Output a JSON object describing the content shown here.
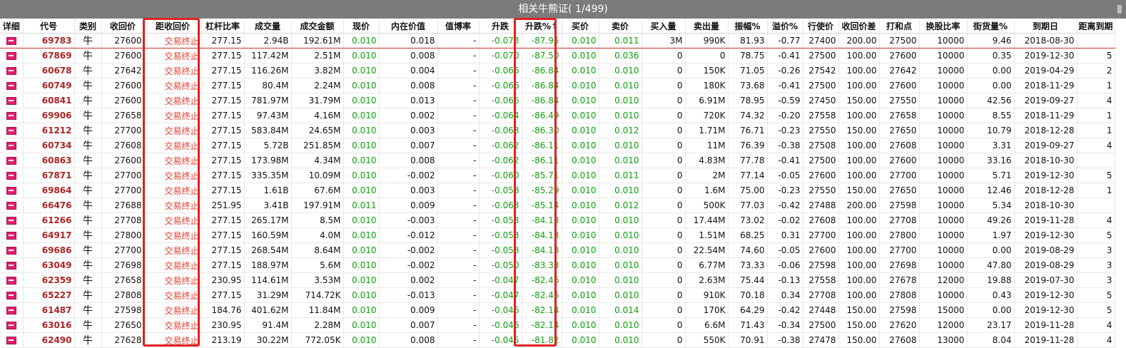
{
  "title": "相关牛熊证( 1/499)",
  "columns": [
    "详细",
    "代号",
    "类别",
    "收回价",
    "距收回价",
    "杠杆比率",
    "成交量",
    "成交金额",
    "现价",
    "内在价值",
    "值博率",
    "升跌",
    "升跌%↑",
    "买价",
    "卖价",
    "买入量",
    "卖出量",
    "振幅%",
    "溢价%",
    "行使价",
    "收回价差",
    "打和点",
    "换股比率",
    "街货量%",
    "到期日",
    "距离到期"
  ],
  "rows": [
    {
      "code": "69783",
      "type": "牛",
      "callprice": "27600",
      "status": "交易终止",
      "leverage": "277.15",
      "volume": "2.94B",
      "turnover": "192.61M",
      "price": "0.010",
      "intrinsic": "0.018",
      "worth": "-",
      "change": "-0.073",
      "changepct": "-87.95",
      "bid": "0.010",
      "ask": "0.011",
      "bidvol": "3M",
      "askvol": "990K",
      "amplitude": "81.93",
      "premium": "-0.77",
      "strike": "27400",
      "calldiff": "200.00",
      "breakeven": "27500",
      "ratio": "10000",
      "outstanding": "9.46",
      "expiry": "2018-08-30",
      "daysleft": ""
    },
    {
      "code": "67869",
      "type": "牛",
      "callprice": "27600",
      "status": "交易终止",
      "leverage": "277.15",
      "volume": "117.42M",
      "turnover": "2.51M",
      "price": "0.010",
      "intrinsic": "0.008",
      "worth": "-",
      "change": "-0.070",
      "changepct": "-87.50",
      "bid": "0.010",
      "ask": "0.036",
      "bidvol": "0",
      "askvol": "0",
      "amplitude": "78.75",
      "premium": "-0.41",
      "strike": "27500",
      "calldiff": "100.00",
      "breakeven": "27600",
      "ratio": "10000",
      "outstanding": "0.35",
      "expiry": "2019-12-30",
      "daysleft": "5"
    },
    {
      "code": "60678",
      "type": "牛",
      "callprice": "27642",
      "status": "交易终止",
      "leverage": "277.15",
      "volume": "116.26M",
      "turnover": "3.82M",
      "price": "0.010",
      "intrinsic": "0.004",
      "worth": "-",
      "change": "-0.066",
      "changepct": "-86.84",
      "bid": "0.010",
      "ask": "0.010",
      "bidvol": "0",
      "askvol": "150K",
      "amplitude": "71.05",
      "premium": "-0.26",
      "strike": "27542",
      "calldiff": "100.00",
      "breakeven": "27642",
      "ratio": "10000",
      "outstanding": "0.00",
      "expiry": "2019-04-29",
      "daysleft": "2"
    },
    {
      "code": "60749",
      "type": "牛",
      "callprice": "27600",
      "status": "交易终止",
      "leverage": "277.15",
      "volume": "80.4M",
      "turnover": "2.24M",
      "price": "0.010",
      "intrinsic": "0.008",
      "worth": "-",
      "change": "-0.066",
      "changepct": "-86.84",
      "bid": "0.010",
      "ask": "0.010",
      "bidvol": "0",
      "askvol": "180K",
      "amplitude": "73.68",
      "premium": "-0.41",
      "strike": "27500",
      "calldiff": "100.00",
      "breakeven": "27600",
      "ratio": "10000",
      "outstanding": "0.00",
      "expiry": "2018-11-29",
      "daysleft": "1"
    },
    {
      "code": "60841",
      "type": "牛",
      "callprice": "27600",
      "status": "交易终止",
      "leverage": "277.15",
      "volume": "781.97M",
      "turnover": "31.79M",
      "price": "0.010",
      "intrinsic": "0.013",
      "worth": "-",
      "change": "-0.066",
      "changepct": "-86.84",
      "bid": "0.010",
      "ask": "0.010",
      "bidvol": "0",
      "askvol": "6.91M",
      "amplitude": "78.95",
      "premium": "-0.59",
      "strike": "27450",
      "calldiff": "150.00",
      "breakeven": "27550",
      "ratio": "10000",
      "outstanding": "42.56",
      "expiry": "2019-09-27",
      "daysleft": "4"
    },
    {
      "code": "69906",
      "type": "牛",
      "callprice": "27658",
      "status": "交易终止",
      "leverage": "277.15",
      "volume": "97.43M",
      "turnover": "4.16M",
      "price": "0.010",
      "intrinsic": "0.002",
      "worth": "-",
      "change": "-0.064",
      "changepct": "-86.49",
      "bid": "0.010",
      "ask": "0.010",
      "bidvol": "0",
      "askvol": "720K",
      "amplitude": "74.32",
      "premium": "-0.20",
      "strike": "27558",
      "calldiff": "100.00",
      "breakeven": "27658",
      "ratio": "10000",
      "outstanding": "8.55",
      "expiry": "2018-11-29",
      "daysleft": "1"
    },
    {
      "code": "61212",
      "type": "牛",
      "callprice": "27700",
      "status": "交易终止",
      "leverage": "277.15",
      "volume": "583.84M",
      "turnover": "24.65M",
      "price": "0.010",
      "intrinsic": "0.003",
      "worth": "-",
      "change": "-0.063",
      "changepct": "-86.30",
      "bid": "0.010",
      "ask": "0.012",
      "bidvol": "0",
      "askvol": "1.71M",
      "amplitude": "76.71",
      "premium": "-0.23",
      "strike": "27550",
      "calldiff": "150.00",
      "breakeven": "27650",
      "ratio": "10000",
      "outstanding": "10.79",
      "expiry": "2018-12-28",
      "daysleft": "1"
    },
    {
      "code": "60734",
      "type": "牛",
      "callprice": "27608",
      "status": "交易终止",
      "leverage": "277.15",
      "volume": "5.72B",
      "turnover": "251.85M",
      "price": "0.010",
      "intrinsic": "0.007",
      "worth": "-",
      "change": "-0.062",
      "changepct": "-86.11",
      "bid": "0.010",
      "ask": "0.010",
      "bidvol": "0",
      "askvol": "11M",
      "amplitude": "76.39",
      "premium": "-0.38",
      "strike": "27508",
      "calldiff": "100.00",
      "breakeven": "27608",
      "ratio": "10000",
      "outstanding": "3.31",
      "expiry": "2019-09-27",
      "daysleft": "4"
    },
    {
      "code": "60863",
      "type": "牛",
      "callprice": "27600",
      "status": "交易终止",
      "leverage": "277.15",
      "volume": "173.98M",
      "turnover": "4.34M",
      "price": "0.010",
      "intrinsic": "0.008",
      "worth": "-",
      "change": "-0.062",
      "changepct": "-86.11",
      "bid": "0.010",
      "ask": "0.010",
      "bidvol": "0",
      "askvol": "4.83M",
      "amplitude": "77.78",
      "premium": "-0.41",
      "strike": "27500",
      "calldiff": "100.00",
      "breakeven": "27600",
      "ratio": "10000",
      "outstanding": "33.16",
      "expiry": "2018-10-30",
      "daysleft": ""
    },
    {
      "code": "67871",
      "type": "牛",
      "callprice": "27700",
      "status": "交易终止",
      "leverage": "277.15",
      "volume": "335.35M",
      "turnover": "10.09M",
      "price": "0.010",
      "intrinsic": "-0.002",
      "worth": "-",
      "change": "-0.060",
      "changepct": "-85.71",
      "bid": "0.010",
      "ask": "0.011",
      "bidvol": "0",
      "askvol": "2M",
      "amplitude": "77.14",
      "premium": "-0.05",
      "strike": "27600",
      "calldiff": "100.00",
      "breakeven": "27700",
      "ratio": "10000",
      "outstanding": "5.71",
      "expiry": "2019-12-30",
      "daysleft": "5"
    },
    {
      "code": "69864",
      "type": "牛",
      "callprice": "27700",
      "status": "交易终止",
      "leverage": "277.15",
      "volume": "1.61B",
      "turnover": "67.6M",
      "price": "0.010",
      "intrinsic": "0.003",
      "worth": "-",
      "change": "-0.058",
      "changepct": "-85.29",
      "bid": "0.010",
      "ask": "0.010",
      "bidvol": "0",
      "askvol": "1.6M",
      "amplitude": "75.00",
      "premium": "-0.23",
      "strike": "27550",
      "calldiff": "150.00",
      "breakeven": "27650",
      "ratio": "10000",
      "outstanding": "12.46",
      "expiry": "2018-12-28",
      "daysleft": "1"
    },
    {
      "code": "66476",
      "type": "牛",
      "callprice": "27688",
      "status": "交易终止",
      "leverage": "251.95",
      "volume": "3.41B",
      "turnover": "197.91M",
      "price": "0.011",
      "intrinsic": "0.009",
      "worth": "-",
      "change": "-0.063",
      "changepct": "-85.14",
      "bid": "0.010",
      "ask": "0.012",
      "bidvol": "0",
      "askvol": "500K",
      "amplitude": "77.03",
      "premium": "-0.42",
      "strike": "27488",
      "calldiff": "200.00",
      "breakeven": "27598",
      "ratio": "10000",
      "outstanding": "5.34",
      "expiry": "2018-10-30",
      "daysleft": ""
    },
    {
      "code": "61266",
      "type": "牛",
      "callprice": "27708",
      "status": "交易终止",
      "leverage": "277.15",
      "volume": "265.17M",
      "turnover": "8.5M",
      "price": "0.010",
      "intrinsic": "-0.003",
      "worth": "-",
      "change": "-0.053",
      "changepct": "-84.13",
      "bid": "0.010",
      "ask": "0.010",
      "bidvol": "0",
      "askvol": "17.44M",
      "amplitude": "73.02",
      "premium": "-0.02",
      "strike": "27608",
      "calldiff": "100.00",
      "breakeven": "27708",
      "ratio": "10000",
      "outstanding": "49.26",
      "expiry": "2019-11-28",
      "daysleft": "4"
    },
    {
      "code": "64917",
      "type": "牛",
      "callprice": "27800",
      "status": "交易终止",
      "leverage": "277.15",
      "volume": "160.59M",
      "turnover": "4.0M",
      "price": "0.010",
      "intrinsic": "-0.012",
      "worth": "-",
      "change": "-0.053",
      "changepct": "-84.13",
      "bid": "0.010",
      "ask": "0.010",
      "bidvol": "0",
      "askvol": "1.51M",
      "amplitude": "68.25",
      "premium": "0.31",
      "strike": "27700",
      "calldiff": "100.00",
      "breakeven": "27800",
      "ratio": "10000",
      "outstanding": "1.97",
      "expiry": "2019-12-30",
      "daysleft": "5"
    },
    {
      "code": "69686",
      "type": "牛",
      "callprice": "27700",
      "status": "交易终止",
      "leverage": "277.15",
      "volume": "268.54M",
      "turnover": "8.64M",
      "price": "0.010",
      "intrinsic": "-0.002",
      "worth": "-",
      "change": "-0.053",
      "changepct": "-84.13",
      "bid": "0.010",
      "ask": "0.010",
      "bidvol": "0",
      "askvol": "22.54M",
      "amplitude": "74.60",
      "premium": "-0.05",
      "strike": "27600",
      "calldiff": "100.00",
      "breakeven": "27700",
      "ratio": "10000",
      "outstanding": "0.00",
      "expiry": "2019-08-29",
      "daysleft": "3"
    },
    {
      "code": "63049",
      "type": "牛",
      "callprice": "27698",
      "status": "交易终止",
      "leverage": "277.15",
      "volume": "188.97M",
      "turnover": "5.6M",
      "price": "0.010",
      "intrinsic": "-0.002",
      "worth": "-",
      "change": "-0.050",
      "changepct": "-83.33",
      "bid": "0.010",
      "ask": "0.010",
      "bidvol": "0",
      "askvol": "6.77M",
      "amplitude": "73.33",
      "premium": "-0.06",
      "strike": "27598",
      "calldiff": "100.00",
      "breakeven": "27698",
      "ratio": "10000",
      "outstanding": "47.80",
      "expiry": "2019-08-29",
      "daysleft": "3"
    },
    {
      "code": "62359",
      "type": "牛",
      "callprice": "27658",
      "status": "交易终止",
      "leverage": "230.95",
      "volume": "114.61M",
      "turnover": "3.53M",
      "price": "0.010",
      "intrinsic": "0.002",
      "worth": "-",
      "change": "-0.047",
      "changepct": "-82.46",
      "bid": "0.010",
      "ask": "0.010",
      "bidvol": "0",
      "askvol": "2.63M",
      "amplitude": "75.44",
      "premium": "-0.13",
      "strike": "27558",
      "calldiff": "100.00",
      "breakeven": "27678",
      "ratio": "12000",
      "outstanding": "19.88",
      "expiry": "2019-07-30",
      "daysleft": "3"
    },
    {
      "code": "65227",
      "type": "牛",
      "callprice": "27808",
      "status": "交易终止",
      "leverage": "277.15",
      "volume": "31.29M",
      "turnover": "714.72K",
      "price": "0.010",
      "intrinsic": "-0.013",
      "worth": "-",
      "change": "-0.047",
      "changepct": "-82.46",
      "bid": "0.010",
      "ask": "0.010",
      "bidvol": "0",
      "askvol": "910K",
      "amplitude": "70.18",
      "premium": "0.34",
      "strike": "27708",
      "calldiff": "100.00",
      "breakeven": "27808",
      "ratio": "10000",
      "outstanding": "0.43",
      "expiry": "2019-12-30",
      "daysleft": "5"
    },
    {
      "code": "61487",
      "type": "牛",
      "callprice": "27598",
      "status": "交易终止",
      "leverage": "184.76",
      "volume": "401.62M",
      "turnover": "11.84M",
      "price": "0.010",
      "intrinsic": "0.009",
      "worth": "-",
      "change": "-0.046",
      "changepct": "-82.14",
      "bid": "0.010",
      "ask": "0.014",
      "bidvol": "0",
      "askvol": "170K",
      "amplitude": "64.29",
      "premium": "-0.42",
      "strike": "27448",
      "calldiff": "150.00",
      "breakeven": "27598",
      "ratio": "15000",
      "outstanding": "0.00",
      "expiry": "2019-12-30",
      "daysleft": "5"
    },
    {
      "code": "63016",
      "type": "牛",
      "callprice": "27650",
      "status": "交易终止",
      "leverage": "230.95",
      "volume": "91.4M",
      "turnover": "2.28M",
      "price": "0.010",
      "intrinsic": "0.007",
      "worth": "-",
      "change": "-0.046",
      "changepct": "-82.14",
      "bid": "0.010",
      "ask": "0.010",
      "bidvol": "0",
      "askvol": "6.6M",
      "amplitude": "71.43",
      "premium": "-0.34",
      "strike": "27500",
      "calldiff": "150.00",
      "breakeven": "27620",
      "ratio": "12000",
      "outstanding": "23.17",
      "expiry": "2019-11-28",
      "daysleft": "4"
    },
    {
      "code": "62490",
      "type": "牛",
      "callprice": "27628",
      "status": "交易终止",
      "leverage": "213.19",
      "volume": "30.22M",
      "turnover": "772.05K",
      "price": "0.010",
      "intrinsic": "0.008",
      "worth": "-",
      "change": "-0.045",
      "changepct": "-81.82",
      "bid": "0.010",
      "ask": "0.010",
      "bidvol": "0",
      "askvol": "550K",
      "amplitude": "70.91",
      "premium": "-0.38",
      "strike": "27478",
      "calldiff": "150.00",
      "breakeven": "27608",
      "ratio": "13000",
      "outstanding": "8.04",
      "expiry": "2019-11-28",
      "daysleft": "4"
    }
  ],
  "colors": {
    "code": "#b22222",
    "positive": "#11a011",
    "status": "#e23b2f",
    "highlight": "#e02020",
    "titlebar": "#7b7b7b"
  },
  "icons": {
    "detail": "detail-icon"
  }
}
